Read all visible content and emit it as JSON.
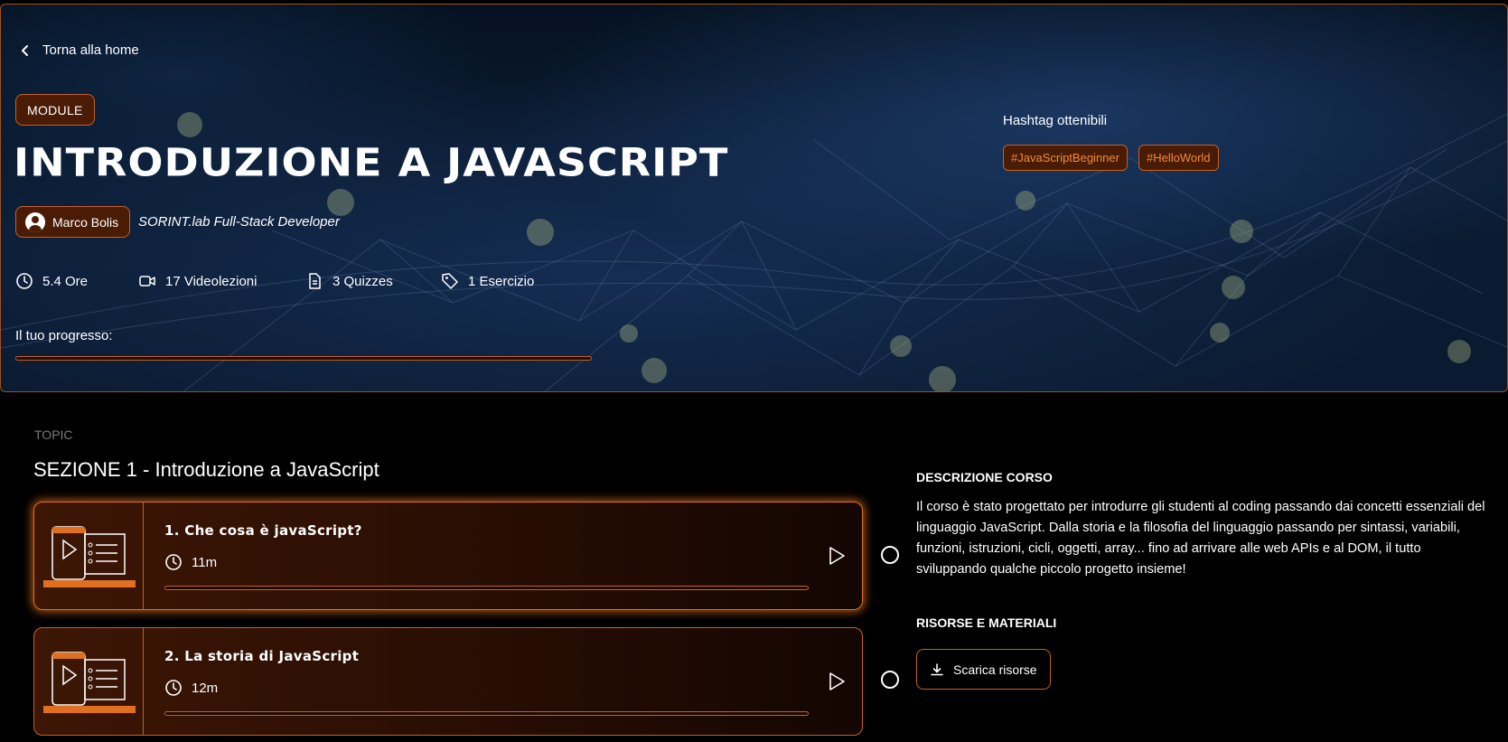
{
  "header": {
    "back_label": "Torna alla home",
    "module_badge": "MODULE",
    "title": "INTRODUZIONE A JAVASCRIPT",
    "author": "Marco Bolis",
    "role": "SORINT.lab Full-Stack Developer",
    "stats": [
      {
        "icon": "clock-icon",
        "label": "5.4 Ore"
      },
      {
        "icon": "video-icon",
        "label": "17 Videolezioni"
      },
      {
        "icon": "document-icon",
        "label": "3 Quizzes"
      },
      {
        "icon": "tag-icon",
        "label": "1 Esercizio"
      }
    ],
    "progress_label": "Il tuo progresso:",
    "progress": 0,
    "hashtag_label": "Hashtag ottenibili",
    "hashtags": [
      "#JavaScriptBeginner",
      "#HelloWorld"
    ]
  },
  "topic": {
    "label": "TOPIC",
    "section_title": "SEZIONE 1 - Introduzione a JavaScript",
    "lessons": [
      {
        "title": "1. Che cosa è javaScript?",
        "duration": "11m",
        "progress": 0,
        "active": true
      },
      {
        "title": "2. La storia di JavaScript",
        "duration": "12m",
        "progress": 0,
        "active": false
      }
    ]
  },
  "description": {
    "title": "DESCRIZIONE CORSO",
    "text": "Il corso è stato progettato per introdurre gli studenti al coding passando dai concetti essenziali del linguaggio JavaScript. Dalla storia e la filosofia del linguaggio passando per sintassi, variabili, funzioni, istruzioni, cicli, oggetti, array... fino ad arrivare alle web APIs e al DOM, il tutto sviluppando qualche piccolo progetto insieme!"
  },
  "resources": {
    "title": "RISORSE E MATERIALI",
    "download_label": "Scarica risorse"
  },
  "colors": {
    "accent": "#e07020",
    "accent_border": "#c8601f",
    "badge_bg": "#4a1c06",
    "hashtag_text": "#f08a3a"
  }
}
